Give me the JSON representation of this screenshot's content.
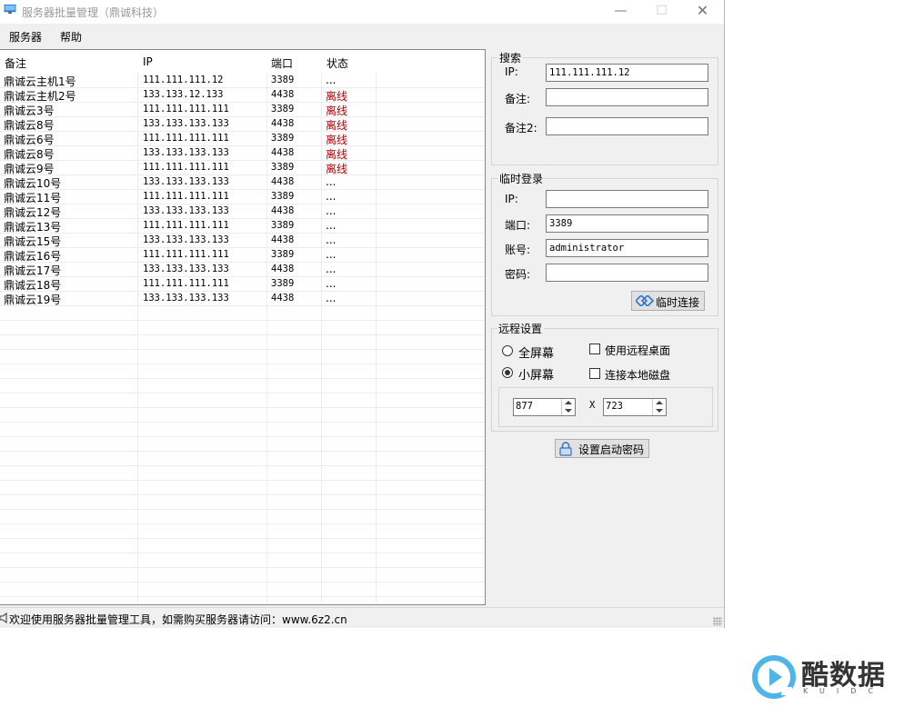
{
  "window": {
    "title": "服务器批量管理（鼎诚科技）",
    "min_glyph": "—",
    "max_glyph": "☐",
    "close_glyph": "✕"
  },
  "menu": {
    "items": [
      "服务器",
      "帮助"
    ]
  },
  "table": {
    "columns": [
      "备注",
      "IP",
      "端口",
      "状态"
    ],
    "rows": [
      [
        "鼎诚云主机1号",
        "111.111.111.12",
        "3389",
        "..."
      ],
      [
        "鼎诚云主机2号",
        "133.133.12.133",
        "4438",
        "离线"
      ],
      [
        "鼎诚云3号",
        "111.111.111.111",
        "3389",
        "离线"
      ],
      [
        "鼎诚云8号",
        "133.133.133.133",
        "4438",
        "离线"
      ],
      [
        "鼎诚云6号",
        "111.111.111.111",
        "3389",
        "离线"
      ],
      [
        "鼎诚云8号",
        "133.133.133.133",
        "4438",
        "离线"
      ],
      [
        "鼎诚云9号",
        "111.111.111.111",
        "3389",
        "离线"
      ],
      [
        "鼎诚云10号",
        "133.133.133.133",
        "4438",
        "..."
      ],
      [
        "鼎诚云11号",
        "111.111.111.111",
        "3389",
        "..."
      ],
      [
        "鼎诚云12号",
        "133.133.133.133",
        "4438",
        "..."
      ],
      [
        "鼎诚云13号",
        "111.111.111.111",
        "3389",
        "..."
      ],
      [
        "鼎诚云15号",
        "133.133.133.133",
        "4438",
        "..."
      ],
      [
        "鼎诚云16号",
        "111.111.111.111",
        "3389",
        "..."
      ],
      [
        "鼎诚云17号",
        "133.133.133.133",
        "4438",
        "..."
      ],
      [
        "鼎诚云18号",
        "111.111.111.111",
        "3389",
        "..."
      ],
      [
        "鼎诚云19号",
        "133.133.133.133",
        "4438",
        "..."
      ]
    ],
    "offline_color": "#b10000"
  },
  "search": {
    "title": "搜索",
    "ip_label": "IP:",
    "ip_value": "111.111.111.12",
    "note_label": "备注:",
    "note_value": "",
    "note2_label": "备注2:",
    "note2_value": ""
  },
  "temp_login": {
    "title": "临时登录",
    "ip_label": "IP:",
    "ip_value": "",
    "port_label": "端口:",
    "port_value": "3389",
    "account_label": "账号:",
    "account_value": "administrator",
    "password_label": "密码:",
    "password_value": "",
    "connect_button": "临时连接"
  },
  "remote": {
    "title": "远程设置",
    "fullscreen_label": "全屏幕",
    "fullscreen_checked": false,
    "small_label": "小屏幕",
    "small_checked": true,
    "use_desktop_label": "使用远程桌面",
    "use_desktop_checked": false,
    "local_disk_label": "连接本地磁盘",
    "local_disk_checked": false,
    "width_value": "877",
    "x_label": "X",
    "height_value": "723"
  },
  "startup_password_button": "设置启动密码",
  "statusbar": {
    "text": "欢迎使用服务器批量管理工具，如需购买服务器请访问：www.6z2.cn"
  },
  "watermark": {
    "name": "酷数据",
    "sub": "KUIDC",
    "brand_color": "#4fb5e8"
  }
}
